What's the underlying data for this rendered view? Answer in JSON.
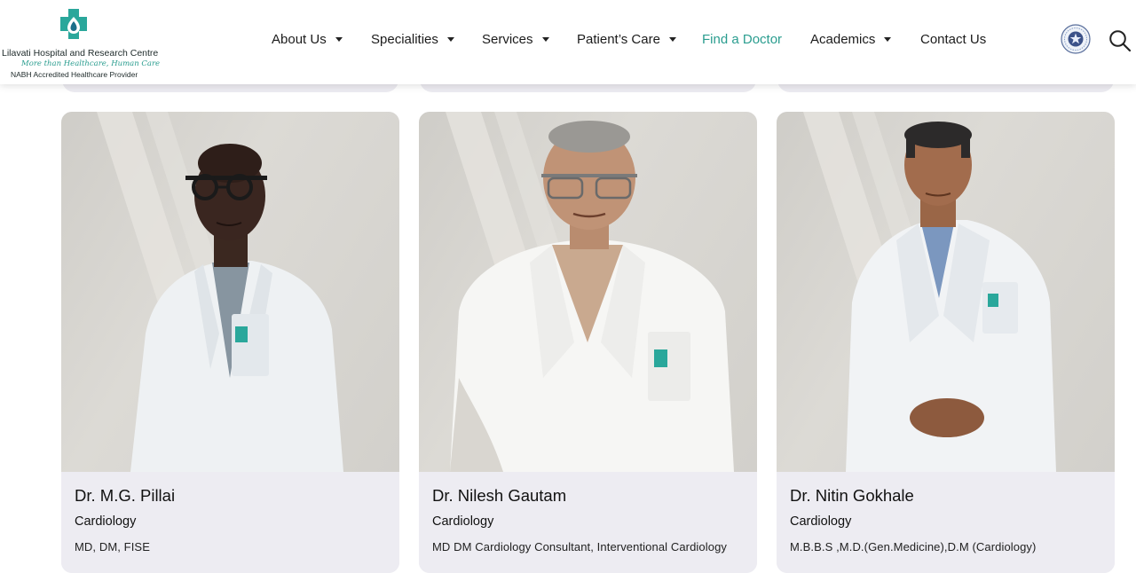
{
  "logo": {
    "name": "Lilavati Hospital and Research Centre",
    "tagline": "More than Healthcare, Human Care",
    "accreditation": "NABH Accredited Healthcare Provider"
  },
  "nav": [
    {
      "label": "About Us",
      "dropdown": true
    },
    {
      "label": "Specialities",
      "dropdown": true
    },
    {
      "label": "Services",
      "dropdown": true
    },
    {
      "label": "Patient’s Care",
      "dropdown": true
    },
    {
      "label": "Find a Doctor",
      "dropdown": false,
      "active": true
    },
    {
      "label": "Academics",
      "dropdown": true
    },
    {
      "label": "Contact Us",
      "dropdown": false
    }
  ],
  "colors": {
    "accent": "#2a9d8f",
    "card_bg": "#edecf2"
  },
  "doctors": [
    {
      "name": "Dr. M.G. Pillai",
      "speciality": "Cardiology",
      "qualification": "MD, DM, FISE"
    },
    {
      "name": "Dr. Nilesh Gautam",
      "speciality": "Cardiology",
      "qualification": "MD DM Cardiology Consultant, Interventional Cardiology"
    },
    {
      "name": "Dr. Nitin Gokhale",
      "speciality": "Cardiology",
      "qualification": "M.B.B.S ,M.D.(Gen.Medicine),D.M (Cardiology)"
    }
  ]
}
